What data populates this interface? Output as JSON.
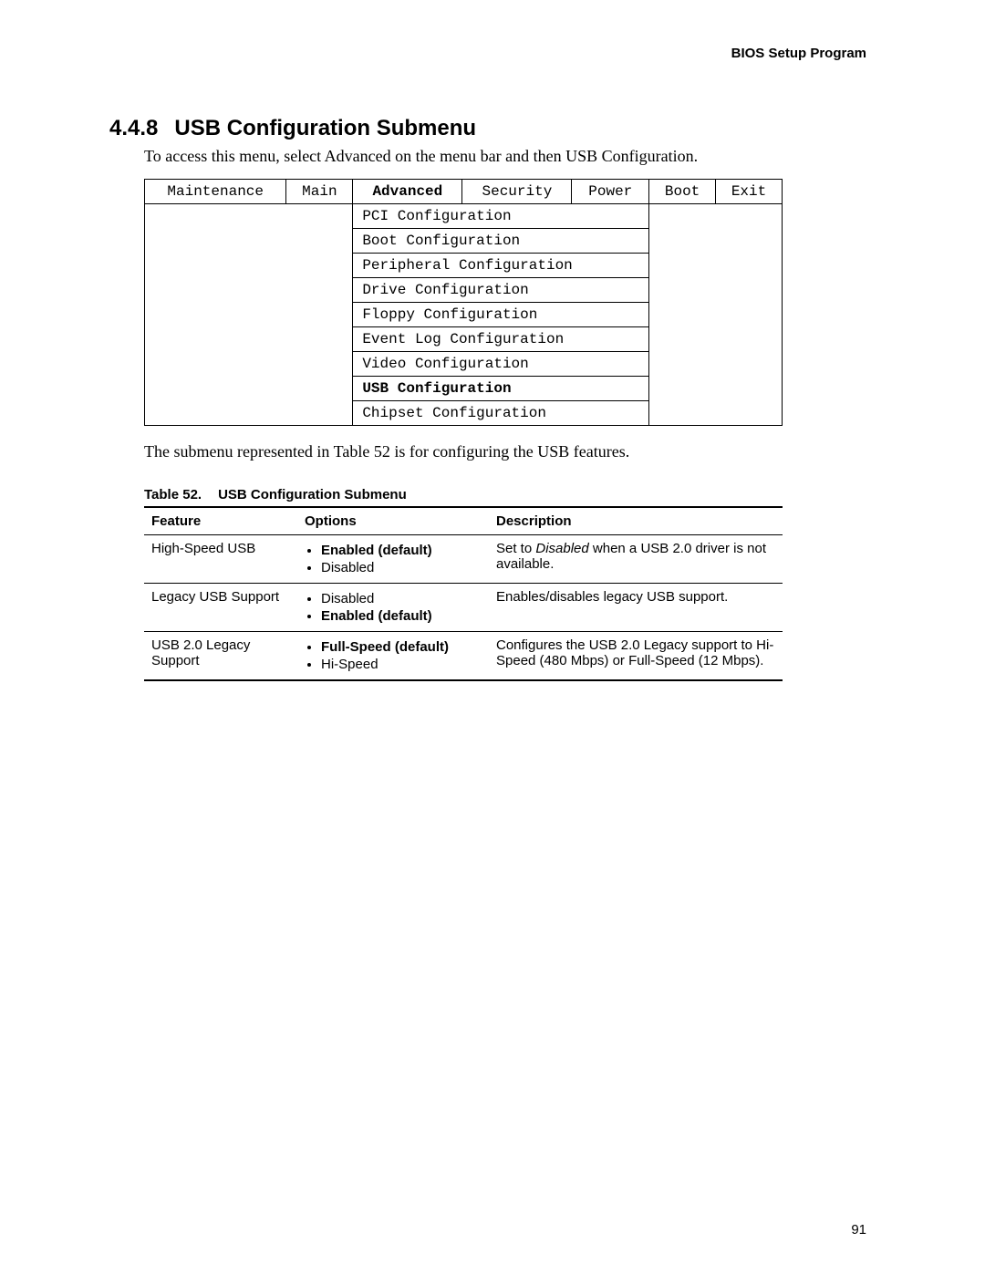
{
  "header": {
    "running": "BIOS Setup Program"
  },
  "section": {
    "number": "4.4.8",
    "title": "USB Configuration Submenu",
    "intro": "To access this menu, select Advanced on the menu bar and then USB Configuration."
  },
  "bios": {
    "tabs": [
      "Maintenance",
      "Main",
      "Advanced",
      "Security",
      "Power",
      "Boot",
      "Exit"
    ],
    "active_tab": "Advanced",
    "submenu": [
      "PCI Configuration",
      "Boot Configuration",
      "Peripheral Configuration",
      "Drive Configuration",
      "Floppy Configuration",
      "Event Log Configuration",
      "Video Configuration",
      "USB Configuration",
      "Chipset Configuration"
    ],
    "active_sub": "USB Configuration"
  },
  "after": "The submenu represented in Table 52 is for configuring the USB features.",
  "table": {
    "number": "Table 52.",
    "title": "USB Configuration Submenu",
    "headers": {
      "feature": "Feature",
      "options": "Options",
      "description": "Description"
    },
    "rows": [
      {
        "feature": "High-Speed USB",
        "options": [
          {
            "text": "Enabled (default)",
            "bold": true
          },
          {
            "text": "Disabled",
            "bold": false
          }
        ],
        "desc_pre": "Set to ",
        "desc_ital": "Disabled",
        "desc_post": " when a USB 2.0 driver is not available."
      },
      {
        "feature": "Legacy USB Support",
        "options": [
          {
            "text": "Disabled",
            "bold": false
          },
          {
            "text": "Enabled (default)",
            "bold": true
          }
        ],
        "desc_pre": "Enables/disables legacy USB support.",
        "desc_ital": "",
        "desc_post": ""
      },
      {
        "feature": "USB 2.0 Legacy Support",
        "options": [
          {
            "text": "Full-Speed (default)",
            "bold": true
          },
          {
            "text": "Hi-Speed",
            "bold": false
          }
        ],
        "desc_pre": "Configures the USB 2.0 Legacy support to Hi-Speed (480 Mbps) or Full-Speed (12 Mbps).",
        "desc_ital": "",
        "desc_post": ""
      }
    ]
  },
  "page_number": "91"
}
